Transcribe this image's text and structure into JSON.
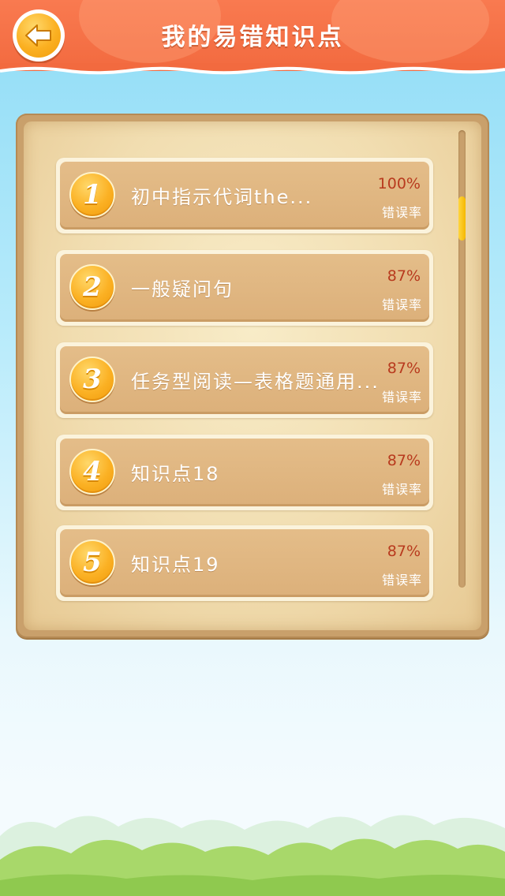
{
  "header": {
    "title": "我的易错知识点",
    "back_icon": "arrow-left-icon"
  },
  "colors": {
    "header_bg": "#f26a3f",
    "rate_text": "#b83a1e",
    "badge_gold": "#fbb021",
    "card_tan": "#dcb07a"
  },
  "list": {
    "rate_label": "错误率",
    "items": [
      {
        "number": "1",
        "title": "初中指示代词the...",
        "rate": "100%"
      },
      {
        "number": "2",
        "title": "一般疑问句",
        "rate": "87%"
      },
      {
        "number": "3",
        "title": "任务型阅读—表格题通用...",
        "rate": "87%"
      },
      {
        "number": "4",
        "title": "知识点18",
        "rate": "87%"
      },
      {
        "number": "5",
        "title": "知识点19",
        "rate": "87%"
      }
    ]
  }
}
